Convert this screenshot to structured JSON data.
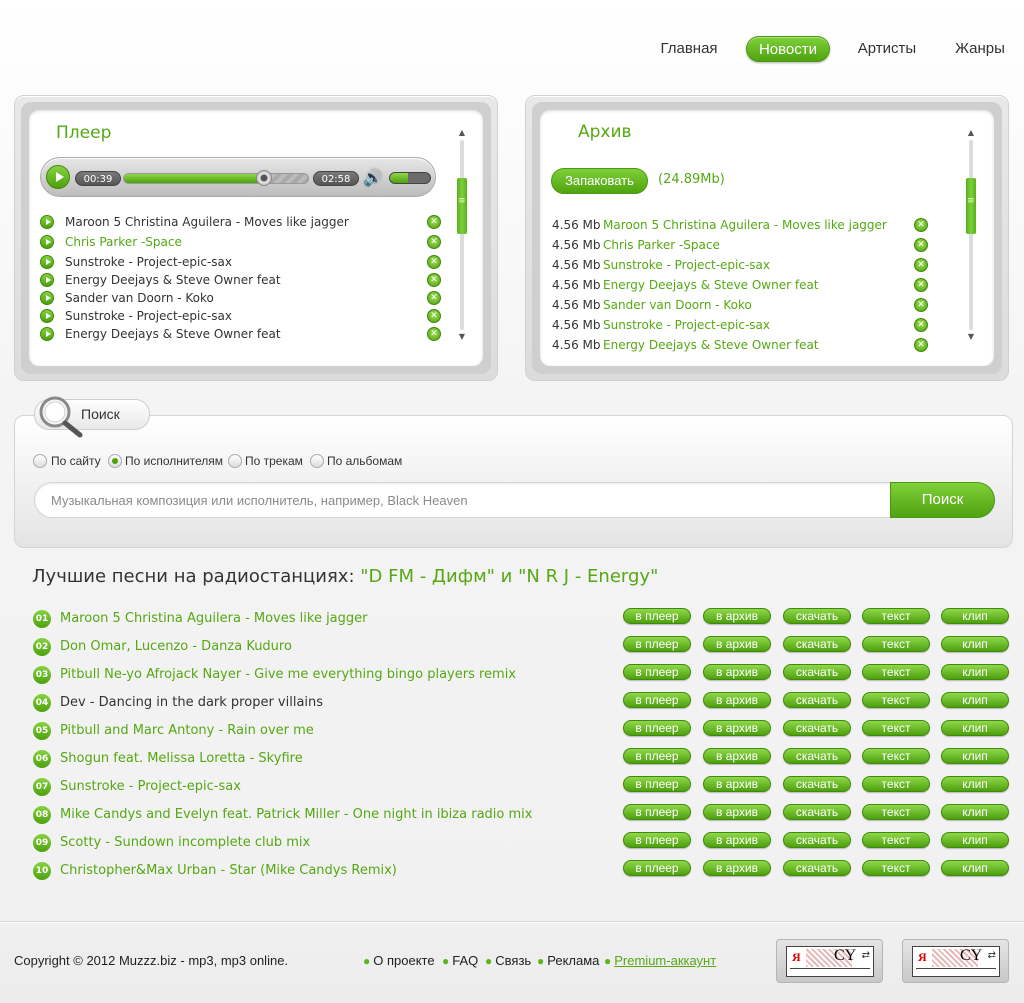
{
  "nav": {
    "items": [
      {
        "label": "Главная",
        "active": false
      },
      {
        "label": "Новости",
        "active": true
      },
      {
        "label": "Артисты",
        "active": false
      },
      {
        "label": "Жанры",
        "active": false
      }
    ]
  },
  "player": {
    "title": "Плеер",
    "time_elapsed": "00:39",
    "time_total": "02:58",
    "progress_fraction": 0.76,
    "volume_fraction": 0.45,
    "tracks": [
      {
        "title": "Maroon 5 Christina Aguilera - Moves like jagger",
        "current": false
      },
      {
        "title": "Chris Parker -Space",
        "current": true
      },
      {
        "title": "Sunstroke - Project-epic-sax",
        "current": false
      },
      {
        "title": "Energy Deejays & Steve Owner feat",
        "current": false
      },
      {
        "title": "Sander van Doorn - Koko",
        "current": false
      },
      {
        "title": "Sunstroke - Project-epic-sax",
        "current": false
      },
      {
        "title": "Energy Deejays & Steve Owner feat",
        "current": false
      }
    ]
  },
  "archive": {
    "title": "Архив",
    "pack_label": "Запаковать",
    "total_size": "(24.89Mb)",
    "items": [
      {
        "size": "4.56 Mb",
        "title": "Maroon 5 Christina Aguilera - Moves like jagger"
      },
      {
        "size": "4.56 Mb",
        "title": "Chris Parker -Space"
      },
      {
        "size": "4.56 Mb",
        "title": "Sunstroke - Project-epic-sax"
      },
      {
        "size": "4.56 Mb",
        "title": "Energy Deejays & Steve Owner feat"
      },
      {
        "size": "4.56 Mb",
        "title": "Sander van Doorn - Koko"
      },
      {
        "size": "4.56 Mb",
        "title": "Sunstroke - Project-epic-sax"
      },
      {
        "size": "4.56 Mb",
        "title": "Energy Deejays & Steve Owner feat"
      }
    ]
  },
  "search": {
    "tab_label": "Поиск",
    "options": [
      {
        "label": "По сайту",
        "selected": false
      },
      {
        "label": "По исполнителям",
        "selected": true
      },
      {
        "label": "По трекам",
        "selected": false
      },
      {
        "label": "По альбомам",
        "selected": false
      }
    ],
    "placeholder": "Музыкальная композиция или исполнитель, например, Black Heaven",
    "button_label": "Поиск"
  },
  "top_songs": {
    "heading_prefix": "Лучшие песни на радиостанциях: ",
    "heading_station1": "\"D FM - Дифм\"",
    "heading_and": " и ",
    "heading_station2": "\"N R J - Energy\"",
    "action_labels": [
      "в плеер",
      "в архив",
      "скачать",
      "текст",
      "клип"
    ],
    "songs": [
      {
        "num": "01",
        "title": "Maroon 5 Christina Aguilera - Moves like jagger",
        "highlight": true
      },
      {
        "num": "02",
        "title": "Don Omar, Lucenzo - Danza Kuduro",
        "highlight": true
      },
      {
        "num": "03",
        "title": "Pitbull Ne-yo Afrojack Nayer - Give me everything bingo players remix",
        "highlight": true
      },
      {
        "num": "04",
        "title": "Dev - Dancing in the dark proper villains",
        "highlight": false
      },
      {
        "num": "05",
        "title": "Pitbull and Marc Antony - Rain over me",
        "highlight": true
      },
      {
        "num": "06",
        "title": "Shogun feat. Melissa Loretta - Skyfire",
        "highlight": true
      },
      {
        "num": "07",
        "title": "Sunstroke - Project-epic-sax",
        "highlight": true
      },
      {
        "num": "08",
        "title": "Mike Candys and Evelyn feat. Patrick Miller - One night in ibiza radio mix",
        "highlight": true
      },
      {
        "num": "09",
        "title": "Scotty - Sundown incomplete club mix",
        "highlight": true
      },
      {
        "num": "10",
        "title": "Christopher&Max Urban - Star (Mike Candys Remix)",
        "highlight": true
      }
    ]
  },
  "footer": {
    "copyright": "Copyright © 2012  Muzzz.biz - mp3, mp3 online.",
    "links": [
      {
        "label": "О проекте",
        "premium": false
      },
      {
        "label": "FAQ",
        "premium": false
      },
      {
        "label": "Связь",
        "premium": false
      },
      {
        "label": "Реклама",
        "premium": false
      },
      {
        "label": "Premium-аккаунт",
        "premium": true
      }
    ],
    "counter_logo_text": "Я",
    "counter_cy_text": "CY"
  },
  "colors": {
    "accent_green": "#55a813",
    "text_dark": "#333333"
  }
}
